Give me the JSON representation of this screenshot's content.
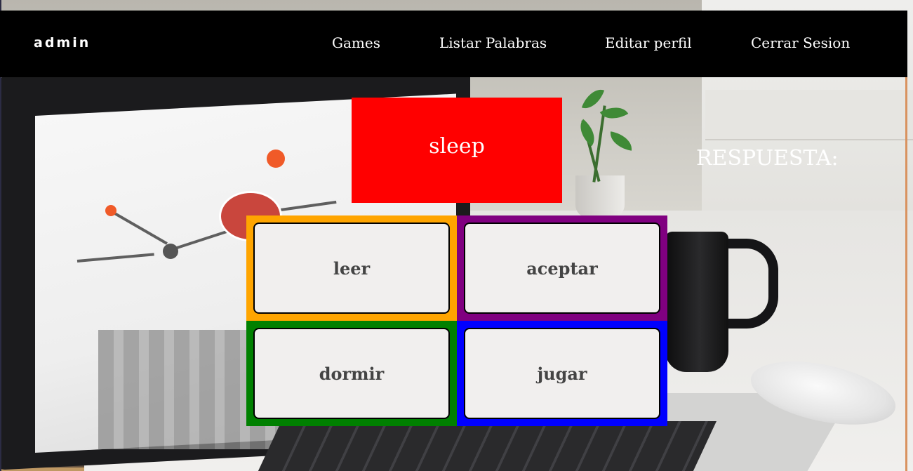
{
  "navbar": {
    "brand": "admin",
    "links": [
      {
        "label": "Games"
      },
      {
        "label": "Listar Palabras"
      },
      {
        "label": "Editar perfil"
      },
      {
        "label": "Cerrar Sesion"
      }
    ]
  },
  "game": {
    "prompt_word": "sleep",
    "prompt_color": "#ff0000",
    "answer_label": "RESPUESTA:",
    "options": [
      {
        "label": "leer",
        "color": "#ffa500"
      },
      {
        "label": "aceptar",
        "color": "#800080"
      },
      {
        "label": "dormir",
        "color": "#008000"
      },
      {
        "label": "jugar",
        "color": "#0000ff"
      }
    ]
  }
}
